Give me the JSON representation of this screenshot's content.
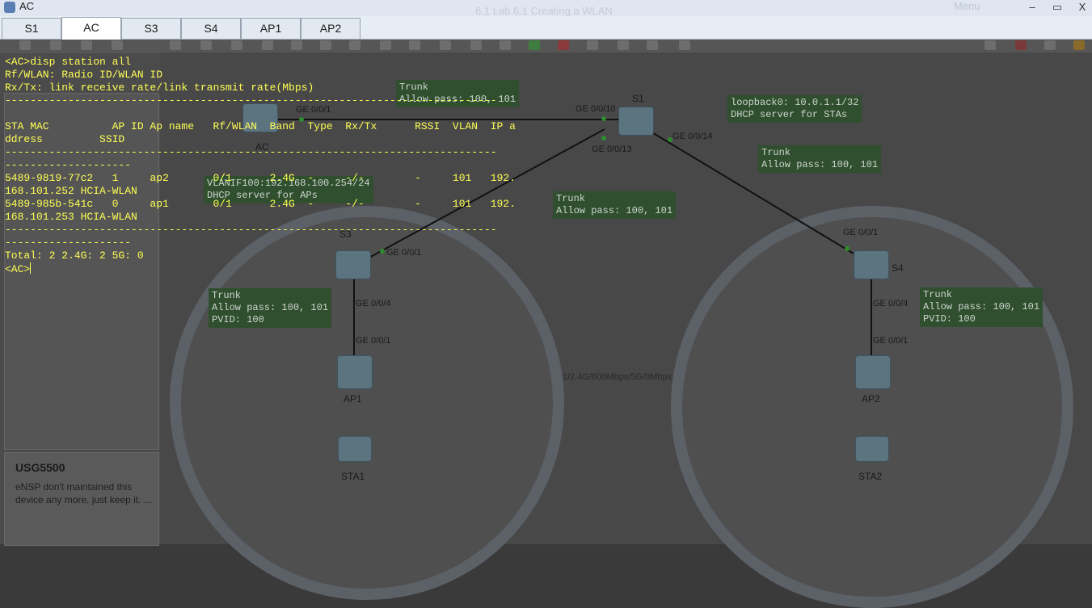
{
  "window": {
    "app_title": "AC",
    "lab_title": "6.1 Lab 6.1 Creating a WLAN",
    "menu_label": "Menu",
    "minimize_glyph": "–",
    "restore_glyph": "▭",
    "close_glyph": "X"
  },
  "tabs": [
    {
      "label": "S1",
      "active": false
    },
    {
      "label": "AC",
      "active": true
    },
    {
      "label": "S3",
      "active": false
    },
    {
      "label": "S4",
      "active": false
    },
    {
      "label": "AP1",
      "active": false
    },
    {
      "label": "AP2",
      "active": false
    }
  ],
  "terminal": {
    "color": "#ffff55",
    "lines": [
      "<AC>disp station all",
      "Rf/WLAN: Radio ID/WLAN ID",
      "Rx/Tx: link receive rate/link transmit rate(Mbps)",
      "------------------------------------------------------------------------------",
      "",
      "STA MAC          AP ID Ap name   Rf/WLAN  Band  Type  Rx/Tx      RSSI  VLAN  IP a",
      "ddress         SSID",
      "------------------------------------------------------------------------------",
      "--------------------",
      "5489-9819-77c2   1     ap2       0/1      2.4G  -     -/-        -     101   192.",
      "168.101.252 HCIA-WLAN",
      "5489-985b-541c   0     ap1       0/1      2.4G  -     -/-        -     101   192.",
      "168.101.253 HCIA-WLAN",
      "------------------------------------------------------------------------------",
      "--------------------",
      "Total: 2 2.4G: 2 5G: 0",
      "<AC>"
    ]
  },
  "side_panel": {
    "title": "USG5500",
    "description": "eNSP don't maintained this device any more, just keep it. ..."
  },
  "topology": {
    "devices": [
      "AC",
      "S1",
      "S3",
      "S4",
      "AP1",
      "AP2",
      "STA1",
      "STA2"
    ],
    "ports": [
      "GE 0/0/1",
      "GE 0/0/10",
      "GE 0/0/13",
      "GE 0/0/14",
      "GE 0/0/1",
      "GE 0/0/4",
      "GE 0/0/1",
      "GE 0/0/1",
      "GE 0/0/4",
      "GE 0/0/1"
    ],
    "notes": {
      "trunk_ac": "Trunk\nAllow pass: 100, 101",
      "loopback": "loopback0: 10.0.1.1/32\nDHCP server for STAs",
      "trunk_s4": "Trunk\nAllow pass: 100, 101",
      "trunk_s3": "Trunk\nAllow pass: 100, 101",
      "vlanif100": "VLANIF100:192.168.100.254/24\nDHCP server for APs",
      "trunk_s3_ap": "Trunk\nAllow pass: 100, 101\nPVID: 100",
      "trunk_s4_ap": "Trunk\nAllow pass: 100, 101\nPVID: 100"
    },
    "radio_stat": "1/2.4G/600Mbps/5G/0Mbps"
  }
}
